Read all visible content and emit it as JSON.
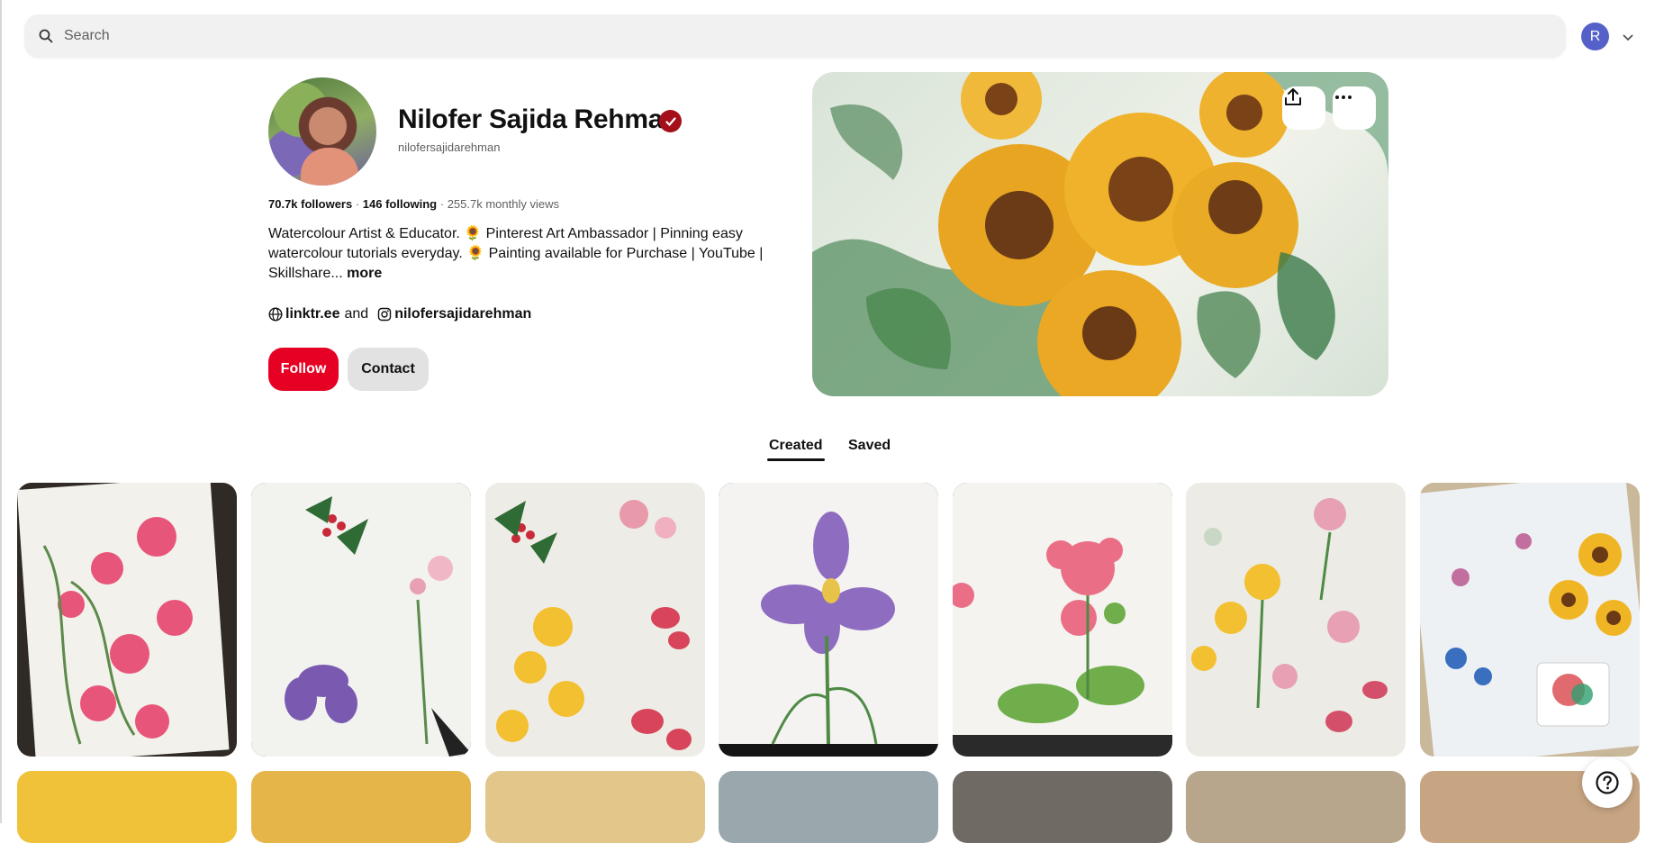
{
  "search": {
    "placeholder": "Search"
  },
  "account": {
    "initial": "R"
  },
  "profile": {
    "name": "Nilofer Sajida Rehman",
    "handle": "nilofersajidarehman",
    "followers": "70.7k followers",
    "separator1": " · ",
    "following": "146 following",
    "separator2": " · ",
    "monthly_views": "255.7k monthly views",
    "bio_line1": "Watercolour Artist & Educator. 🌻 Pinterest Art Ambassador | Pinning easy",
    "bio_line2": "watercolour tutorials everyday. 🌻 Painting available for Purchase | YouTube |",
    "bio_line3": "Skillshare...",
    "bio_more": "more",
    "link_website": "linktr.ee",
    "link_and": "and",
    "link_instagram": "nilofersajidarehman"
  },
  "actions": {
    "follow_label": "Follow",
    "contact_label": "Contact"
  },
  "tabs": [
    {
      "label": "Created",
      "active": true
    },
    {
      "label": "Saved",
      "active": false
    }
  ],
  "colors": {
    "follow": "#e60023",
    "verified": "#a40f1a",
    "avatar": "#5561c8"
  },
  "pins": [
    {
      "subject": "pink poppies watercolour"
    },
    {
      "subject": "holly, peony and iris studies"
    },
    {
      "subject": "holly, daffodils and tulips"
    },
    {
      "subject": "purple iris"
    },
    {
      "subject": "pink lotus with leaves"
    },
    {
      "subject": "daffodils, peonies, tulips"
    },
    {
      "subject": "sunflowers and thistles with palette"
    }
  ]
}
